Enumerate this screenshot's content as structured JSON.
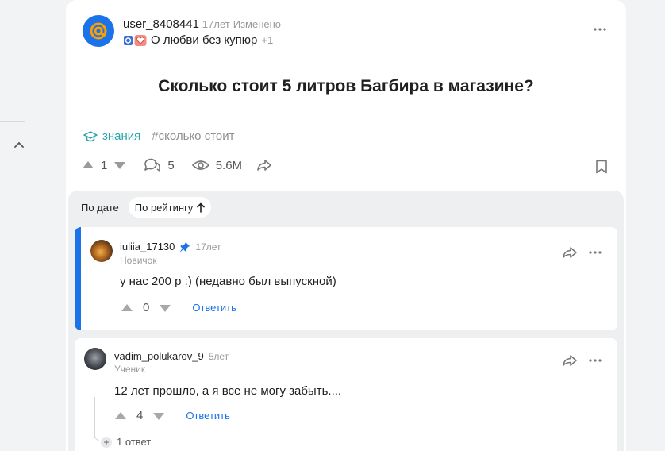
{
  "question": {
    "author": "user_8408441",
    "time": "17лет",
    "edited_label": "Изменено",
    "category": "О любви без купюр",
    "category_extra": "+1",
    "title": "Сколько стоит 5 литров Багбира в магазине?",
    "topic_tag": "знания",
    "hashtag": "#сколько стоит",
    "likes": "1",
    "comments": "5",
    "views": "5.6M"
  },
  "sort": {
    "by_date": "По дате",
    "by_rating": "По рейтингу"
  },
  "answers": [
    {
      "author": "iuliia_17130",
      "time": "17лет",
      "rank": "Новичок",
      "text": "у нас 200 р :) (недавно был выпускной)",
      "votes": "0",
      "reply_label": "Ответить"
    },
    {
      "author": "vadim_polukarov_9",
      "time": "5лет",
      "rank": "Ученик",
      "text": "12 лет прошло, а я все не могу забыть....",
      "votes": "4",
      "reply_label": "Ответить",
      "replies_count": "1 ответ"
    }
  ],
  "colors": {
    "accent": "#1a73e8",
    "topic": "#26a3ac"
  },
  "icons": [
    "chevron-up-icon",
    "mail-at-icon",
    "more-icon",
    "mortarboard-icon",
    "arrow-up-icon",
    "arrow-down-icon",
    "comment-icon",
    "eye-icon",
    "share-icon",
    "bookmark-icon",
    "pin-icon",
    "plus-icon"
  ]
}
